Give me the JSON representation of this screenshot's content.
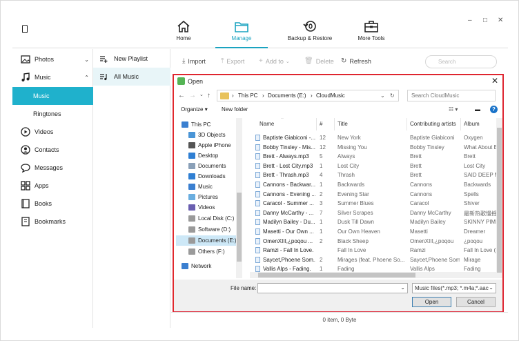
{
  "header": {
    "nav": [
      {
        "label": "Home",
        "icon": "home-icon"
      },
      {
        "label": "Manage",
        "icon": "folder-icon",
        "active": true
      },
      {
        "label": "Backup & Restore",
        "icon": "backup-restore-icon"
      },
      {
        "label": "More Tools",
        "icon": "toolbox-icon"
      }
    ],
    "window_controls": [
      "–",
      "□",
      "✕"
    ]
  },
  "sidebar": {
    "items": [
      {
        "label": "Photos",
        "icon": "photo-icon",
        "chevron": "⌄"
      },
      {
        "label": "Music",
        "icon": "music-note-icon",
        "chevron": "⌃"
      },
      {
        "label": "Music",
        "sub": true,
        "active": true
      },
      {
        "label": "Ringtones",
        "sub": true
      },
      {
        "label": "Videos",
        "icon": "play-icon"
      },
      {
        "label": "Contacts",
        "icon": "contacts-icon"
      },
      {
        "label": "Messages",
        "icon": "message-icon"
      },
      {
        "label": "Apps",
        "icon": "apps-icon"
      },
      {
        "label": "Books",
        "icon": "book-icon"
      },
      {
        "label": "Bookmarks",
        "icon": "bookmark-icon"
      }
    ]
  },
  "playlists": {
    "new_label": "New Playlist",
    "all_label": "All Music"
  },
  "toolbar": {
    "import": "Import",
    "export": "Export",
    "add_to": "Add to",
    "delete": "Delete",
    "refresh": "Refresh",
    "search_placeholder": "Search"
  },
  "status": {
    "text": "0 item, 0 Byte"
  },
  "dialog": {
    "title": "Open",
    "breadcrumb": [
      "This PC",
      "Documents (E:)",
      "CloudMusic"
    ],
    "search_placeholder": "Search CloudMusic",
    "organize": "Organize",
    "new_folder": "New folder",
    "nav_items": [
      {
        "label": "This PC",
        "icon": "pc-icon",
        "color": "#3a7fd0"
      },
      {
        "label": "3D Objects",
        "icon": "3d-objects-icon",
        "color": "#4a95d6"
      },
      {
        "label": "Apple iPhone",
        "icon": "phone-icon",
        "color": "#555555"
      },
      {
        "label": "Desktop",
        "icon": "desktop-icon",
        "color": "#2f7fd3"
      },
      {
        "label": "Documents",
        "icon": "documents-icon",
        "color": "#8aa0b8"
      },
      {
        "label": "Downloads",
        "icon": "downloads-icon",
        "color": "#2f7fd3"
      },
      {
        "label": "Music",
        "icon": "music-icon",
        "color": "#3a7fd0"
      },
      {
        "label": "Pictures",
        "icon": "pictures-icon",
        "color": "#6aaee0"
      },
      {
        "label": "Videos",
        "icon": "videos-icon",
        "color": "#6a5fb0"
      },
      {
        "label": "Local Disk (C:)",
        "icon": "drive-icon",
        "color": "#9a9a9a"
      },
      {
        "label": "Software (D:)",
        "icon": "drive-icon",
        "color": "#9a9a9a"
      },
      {
        "label": "Documents (E:)",
        "icon": "drive-icon",
        "color": "#9a9a9a",
        "selected": true
      },
      {
        "label": "Others (F:)",
        "icon": "drive-icon",
        "color": "#9a9a9a"
      },
      {
        "label": "Network",
        "icon": "network-icon",
        "color": "#3a7fd0"
      }
    ],
    "columns": [
      "Name",
      "#",
      "Title",
      "Contributing artists",
      "Album"
    ],
    "files": [
      {
        "name": "Baptiste Giabiconi -...",
        "no": "12",
        "title": "New York",
        "artist": "Baptiste Giabiconi",
        "album": "Oxygen"
      },
      {
        "name": "Bobby Tinsley - Mis...",
        "no": "12",
        "title": "Missing You",
        "artist": "Bobby Tinsley",
        "album": "What About B"
      },
      {
        "name": "Brett - Always.mp3",
        "no": "5",
        "title": "Always",
        "artist": "Brett",
        "album": "Brett"
      },
      {
        "name": "Brett - Lost City.mp3",
        "no": "1",
        "title": "Lost City",
        "artist": "Brett",
        "album": "Lost City"
      },
      {
        "name": "Brett - Thrash.mp3",
        "no": "4",
        "title": "Thrash",
        "artist": "Brett",
        "album": "SAID DEEP MI"
      },
      {
        "name": "Cannons - Backwar...",
        "no": "1",
        "title": "Backwards",
        "artist": "Cannons",
        "album": "Backwards"
      },
      {
        "name": "Cannons - Evening ...",
        "no": "2",
        "title": "Evening Star",
        "artist": "Cannons",
        "album": "Spells"
      },
      {
        "name": "Caracol - Summer ...",
        "no": "3",
        "title": "Summer Blues",
        "artist": "Caracol",
        "album": "Shiver"
      },
      {
        "name": "Danny McCarthy - ...",
        "no": "7",
        "title": "Silver Scrapes",
        "artist": "Danny McCarthy",
        "album": "最新热歌慢摇"
      },
      {
        "name": "Madilyn Bailey - Du...",
        "no": "1",
        "title": "Dusk Till Dawn",
        "artist": "Madilyn Bailey",
        "album": "SKINNY PIMPI"
      },
      {
        "name": "Masetti - Our Own ...",
        "no": "1",
        "title": "Our Own Heaven",
        "artist": "Masetti",
        "album": "Dreamer"
      },
      {
        "name": "OmenXIII,¿poqou ...",
        "no": "2",
        "title": "Black Sheep",
        "artist": "OmenXIII,¿poqou",
        "album": "¿poqou"
      },
      {
        "name": "Ramzi - Fall In Love.",
        "no": "",
        "title": "Fall In Love",
        "artist": "Ramzi",
        "album": "Fall In Love (R"
      },
      {
        "name": "Saycet,Phoene Som...",
        "no": "2",
        "title": "Mirages (feat. Phoene So...",
        "artist": "Saycet,Phoene Som",
        "album": "Mirage"
      },
      {
        "name": "Vallis Alps - Fading.",
        "no": "1",
        "title": "Fading",
        "artist": "Vallis Alps",
        "album": "Fading"
      }
    ],
    "file_name_label": "File name:",
    "file_name_value": "",
    "file_type": "Music files(*.mp3; *.m4a;*.aac;*",
    "open_button": "Open",
    "cancel_button": "Cancel"
  }
}
